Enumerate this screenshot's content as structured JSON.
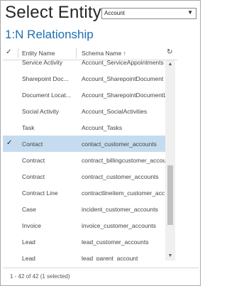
{
  "header": {
    "title": "Select Entity",
    "entity_select": {
      "value": "Account",
      "icon": "chevron-down-icon"
    }
  },
  "subtitle": "1:N Relationship",
  "grid": {
    "columns": {
      "check_icon": "checkmark-icon",
      "entity_name": "Entity Name",
      "schema_name": "Schema Name",
      "sort_icon": "arrow-up-icon",
      "refresh_icon": "refresh-icon"
    },
    "rows": [
      {
        "entity": "Service Activity",
        "schema": "Account_ServiceAppointments",
        "selected": false
      },
      {
        "entity": "Sharepoint Doc...",
        "schema": "Account_SharepointDocument",
        "selected": false
      },
      {
        "entity": "Document Locat...",
        "schema": "Account_SharepointDocumentL",
        "selected": false
      },
      {
        "entity": "Social Activity",
        "schema": "Account_SocialActivities",
        "selected": false
      },
      {
        "entity": "Task",
        "schema": "Account_Tasks",
        "selected": false
      },
      {
        "entity": "Contact",
        "schema": "contact_customer_accounts",
        "selected": true
      },
      {
        "entity": "Contract",
        "schema": "contract_billingcustomer_accou",
        "selected": false
      },
      {
        "entity": "Contract",
        "schema": "contract_customer_accounts",
        "selected": false
      },
      {
        "entity": "Contract Line",
        "schema": "contractlineitem_customer_acc",
        "selected": false
      },
      {
        "entity": "Case",
        "schema": "incident_customer_accounts",
        "selected": false
      },
      {
        "entity": "Invoice",
        "schema": "invoice_customer_accounts",
        "selected": false
      },
      {
        "entity": "Lead",
        "schema": "lead_customer_accounts",
        "selected": false
      },
      {
        "entity": "Lead",
        "schema": "lead_parent_account",
        "selected": false
      }
    ]
  },
  "footer": {
    "status": "1 - 42 of 42 (1 selected)"
  }
}
